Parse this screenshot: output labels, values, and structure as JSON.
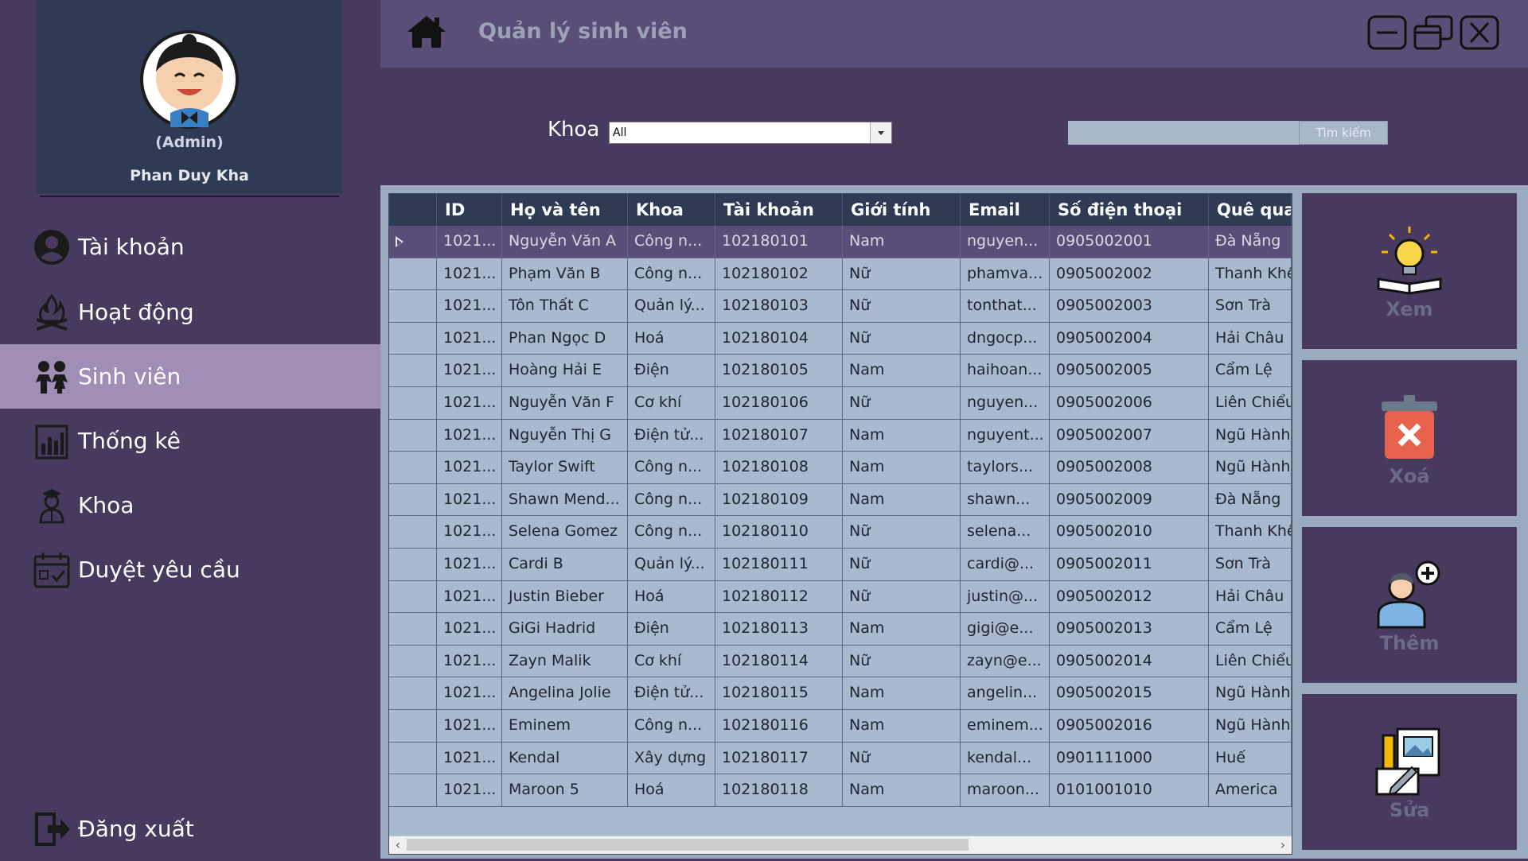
{
  "sidebar": {
    "role": "(Admin)",
    "username": "Phan Duy Kha",
    "items": [
      {
        "label": "Tài khoản",
        "icon": "user-circle-icon"
      },
      {
        "label": "Hoạt động",
        "icon": "campfire-icon"
      },
      {
        "label": "Sinh viên",
        "icon": "students-icon",
        "active": true
      },
      {
        "label": "Thống kê",
        "icon": "statistics-icon"
      },
      {
        "label": "Khoa",
        "icon": "teacher-icon"
      },
      {
        "label": "Duyệt yêu cầu",
        "icon": "calendar-check-icon"
      }
    ],
    "logout": {
      "label": "Đăng xuất",
      "icon": "logout-icon"
    }
  },
  "header": {
    "title": "Quản lý sinh viên"
  },
  "filter": {
    "khoa_label": "Khoa",
    "khoa_selected": "All",
    "search_value": "",
    "search_button": "Tìm kiếm"
  },
  "table": {
    "columns": [
      "ID",
      "Họ và tên",
      "Khoa",
      "Tài khoản",
      "Giới tính",
      "Email",
      "Số điện thoại",
      "Quê qua"
    ],
    "rows": [
      [
        "1021...",
        "Nguyễn Văn A",
        "Công n...",
        "102180101",
        "Nam",
        "nguyen...",
        "0905002001",
        "Đà Nẵng"
      ],
      [
        "1021...",
        "Phạm Văn B",
        "Công n...",
        "102180102",
        "Nữ",
        "phamva...",
        "0905002002",
        "Thanh Khê"
      ],
      [
        "1021...",
        "Tôn Thất C",
        "Quản lý...",
        "102180103",
        "Nữ",
        "tonthat...",
        "0905002003",
        "Sơn Trà"
      ],
      [
        "1021...",
        "Phan Ngọc D",
        "Hoá",
        "102180104",
        "Nữ",
        "dngocp...",
        "0905002004",
        "Hải Châu"
      ],
      [
        "1021...",
        "Hoàng Hải E",
        "Điện",
        "102180105",
        "Nam",
        "haihoan...",
        "0905002005",
        "Cẩm Lệ"
      ],
      [
        "1021...",
        "Nguyễn Văn F",
        "Cơ khí",
        "102180106",
        "Nữ",
        "nguyen...",
        "0905002006",
        "Liên Chiểu"
      ],
      [
        "1021...",
        "Nguyễn Thị G",
        "Điện tử...",
        "102180107",
        "Nam",
        "nguyent...",
        "0905002007",
        "Ngũ Hành"
      ],
      [
        "1021...",
        "Taylor Swift",
        "Công n...",
        "102180108",
        "Nam",
        "taylors...",
        "0905002008",
        "Ngũ Hành"
      ],
      [
        "1021...",
        "Shawn Mend...",
        "Công n...",
        "102180109",
        "Nam",
        "shawn...",
        "0905002009",
        "Đà Nẵng"
      ],
      [
        "1021...",
        "Selena Gomez",
        "Công n...",
        "102180110",
        "Nữ",
        "selena...",
        "0905002010",
        "Thanh Khê"
      ],
      [
        "1021...",
        "Cardi B",
        "Quản lý...",
        "102180111",
        "Nữ",
        "cardi@...",
        "0905002011",
        "Sơn Trà"
      ],
      [
        "1021...",
        "Justin Bieber",
        "Hoá",
        "102180112",
        "Nữ",
        "justin@...",
        "0905002012",
        "Hải Châu"
      ],
      [
        "1021...",
        "GiGi Hadrid",
        "Điện",
        "102180113",
        "Nam",
        "gigi@e...",
        "0905002013",
        "Cẩm Lệ"
      ],
      [
        "1021...",
        "Zayn Malik",
        "Cơ khí",
        "102180114",
        "Nữ",
        "zayn@e...",
        "0905002014",
        "Liên Chiểu"
      ],
      [
        "1021...",
        "Angelina Jolie",
        "Điện tử...",
        "102180115",
        "Nam",
        "angelin...",
        "0905002015",
        "Ngũ Hành"
      ],
      [
        "1021...",
        "Eminem",
        "Công n...",
        "102180116",
        "Nam",
        "eminem...",
        "0905002016",
        "Ngũ Hành"
      ],
      [
        "1021...",
        "Kendal",
        "Xây dựng",
        "102180117",
        "Nữ",
        "kendal...",
        "0901111000",
        "Huế"
      ],
      [
        "1021...",
        "Maroon 5",
        "Hoá",
        "102180118",
        "Nam",
        "maroon...",
        "0101001010",
        "America"
      ]
    ],
    "selected_row": 0
  },
  "actions": [
    {
      "label": "Xem",
      "icon": "lightbulb-book-icon"
    },
    {
      "label": "Xoá",
      "icon": "trash-delete-icon"
    },
    {
      "label": "Thêm",
      "icon": "add-user-icon"
    },
    {
      "label": "Sửa",
      "icon": "edit-document-icon"
    }
  ],
  "colors": {
    "background": "#483a5e",
    "header": "#5a4e78",
    "profile": "#2f3a55",
    "active_nav": "#a08eb7",
    "grid": "#a9b9cf"
  }
}
